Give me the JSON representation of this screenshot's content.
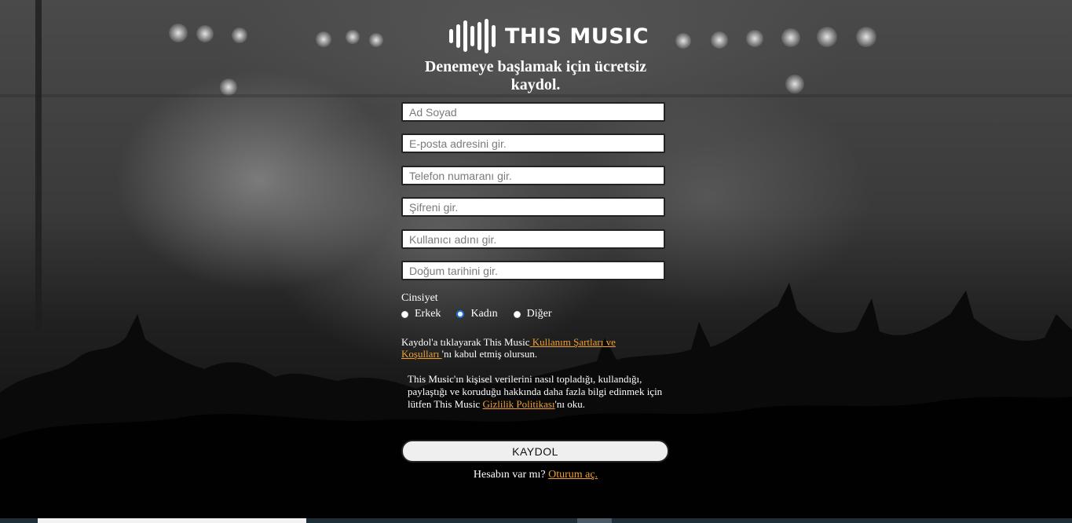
{
  "brand": {
    "name": "THIS MUSIC",
    "logo_icon": "sound-bars-icon"
  },
  "headline": "Denemeye başlamak için ücretsiz kaydol.",
  "form": {
    "full_name_placeholder": "Ad Soyad",
    "email_placeholder": "E-posta adresini gir.",
    "phone_placeholder": "Telefon numaranı gir.",
    "password_placeholder": "Şifreni gir.",
    "username_placeholder": "Kullanıcı adını gir.",
    "birthdate_placeholder": "Doğum tarihini gir.",
    "gender_label": "Cinsiyet",
    "gender_options": [
      "Erkek",
      "Kadın",
      "Diğer"
    ],
    "gender_selected": "Kadın",
    "terms_prefix": "Kaydol'a tıklayarak This Music",
    "terms_link": " Kullanım Şartları ve Koşulları ",
    "terms_suffix": "'nı kabul etmiş olursun.",
    "privacy_prefix": "This Music'ın kişisel verilerini nasıl topladığı, kullandığı, paylaştığı ve koruduğu hakkında daha fazla bilgi edinmek için lütfen This Music ",
    "privacy_link": "Gizlilik Politikası",
    "privacy_suffix": "'nı oku.",
    "submit_label": "KAYDOL",
    "login_prompt": "Hesabın var mı? ",
    "login_link": "Oturum aç."
  },
  "colors": {
    "link": "#f0a030",
    "radio_selected": "#1a73e8",
    "taskbar": "#1e2f3a"
  }
}
